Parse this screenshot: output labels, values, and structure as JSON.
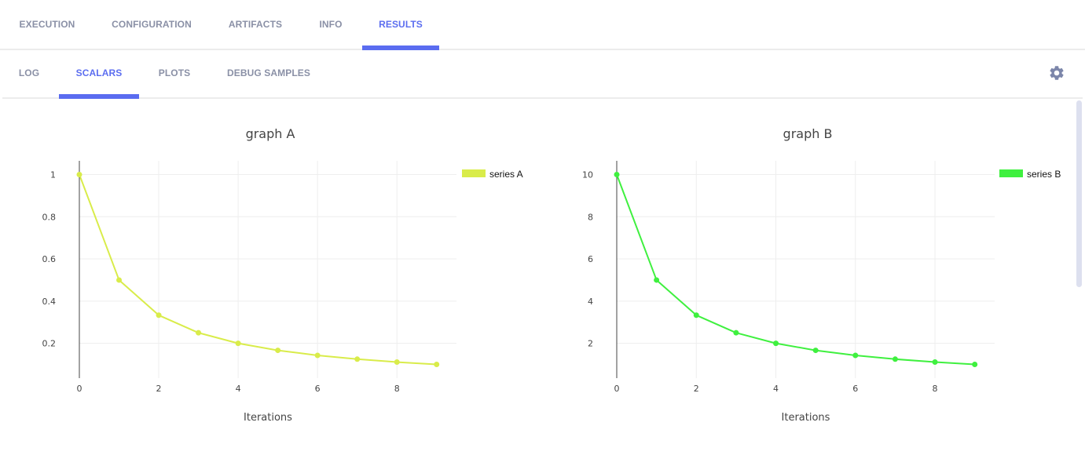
{
  "tabs": [
    {
      "label": "EXECUTION",
      "active": false
    },
    {
      "label": "CONFIGURATION",
      "active": false
    },
    {
      "label": "ARTIFACTS",
      "active": false
    },
    {
      "label": "INFO",
      "active": false
    },
    {
      "label": "RESULTS",
      "active": true
    }
  ],
  "subtabs": [
    {
      "label": "LOG",
      "active": false
    },
    {
      "label": "SCALARS",
      "active": true
    },
    {
      "label": "PLOTS",
      "active": false
    },
    {
      "label": "DEBUG SAMPLES",
      "active": false
    }
  ],
  "settings_icon": "gear-icon",
  "chart_data": [
    {
      "type": "line",
      "title": "graph A",
      "xlabel": "Iterations",
      "ylabel": "",
      "x": [
        0,
        1,
        2,
        3,
        4,
        5,
        6,
        7,
        8,
        9
      ],
      "series": [
        {
          "name": "series A",
          "color": "#d9ec4a",
          "values": [
            1,
            0.5,
            0.3333,
            0.25,
            0.2,
            0.1667,
            0.1429,
            0.125,
            0.1111,
            0.1
          ]
        }
      ],
      "xticks": [
        "0",
        "2",
        "4",
        "6",
        "8"
      ],
      "xtick_values": [
        0,
        2,
        4,
        6,
        8
      ],
      "yticks": [
        "0.2",
        "0.4",
        "0.6",
        "0.8",
        "1"
      ],
      "ytick_values": [
        0.2,
        0.4,
        0.6,
        0.8,
        1
      ],
      "xlim": [
        0,
        9.5
      ],
      "ylim": [
        0.035,
        1.065
      ],
      "grid": true,
      "legend": "top-right"
    },
    {
      "type": "line",
      "title": "graph B",
      "xlabel": "Iterations",
      "ylabel": "",
      "x": [
        0,
        1,
        2,
        3,
        4,
        5,
        6,
        7,
        8,
        9
      ],
      "series": [
        {
          "name": "series B",
          "color": "#3ff03f",
          "values": [
            10,
            5,
            3.333,
            2.5,
            2,
            1.667,
            1.429,
            1.25,
            1.111,
            1
          ]
        }
      ],
      "xticks": [
        "0",
        "2",
        "4",
        "6",
        "8"
      ],
      "xtick_values": [
        0,
        2,
        4,
        6,
        8
      ],
      "yticks": [
        "2",
        "4",
        "6",
        "8",
        "10"
      ],
      "ytick_values": [
        2,
        4,
        6,
        8,
        10
      ],
      "xlim": [
        0,
        9.5
      ],
      "ylim": [
        0.35,
        10.65
      ],
      "grid": true,
      "legend": "top-right"
    }
  ]
}
